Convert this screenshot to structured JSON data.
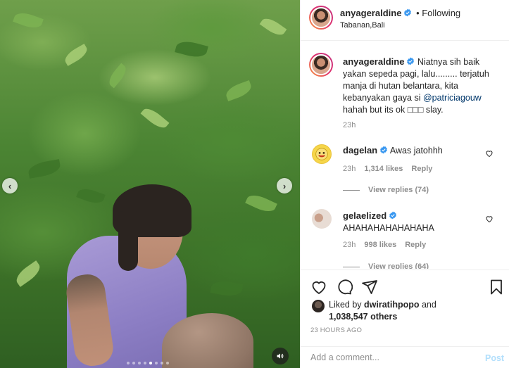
{
  "post": {
    "username": "anyageraldine",
    "follow_status": "Following",
    "location": "Tabanan,Bali"
  },
  "caption": {
    "username": "anyageraldine",
    "text_before_mention": "Niatnya sih baik yakan sepeda pagi, lalu......... terjatuh manja di hutan belantara, kita kebanyakan gaya si ",
    "mention": "@patriciagouw",
    "text_after_mention": " hahah but its ok □□□ slay.",
    "time": "23h"
  },
  "comments": [
    {
      "username": "dagelan",
      "text": "Awas jatohhh",
      "time": "23h",
      "likes": "1,314 likes",
      "reply_label": "Reply",
      "view_replies": "View replies (74)"
    },
    {
      "username": "gelaelized",
      "text": "AHAHAHAHAHAHAHA",
      "time": "23h",
      "likes": "998 likes",
      "reply_label": "Reply",
      "view_replies": "View replies (64)"
    }
  ],
  "likes": {
    "prefix": "Liked by ",
    "user": "dwiratihpopo",
    "and": " and",
    "others": "1,038,547 others"
  },
  "timestamp": "23 HOURS AGO",
  "comment_box": {
    "placeholder": "Add a comment...",
    "post_label": "Post"
  },
  "media": {
    "prev_icon": "‹",
    "next_icon": "›",
    "carousel_total": 8,
    "carousel_active": 5
  },
  "colors": {
    "verified": "#3897f0",
    "post_button_disabled": "#b2dffc",
    "mention": "#00376b"
  }
}
